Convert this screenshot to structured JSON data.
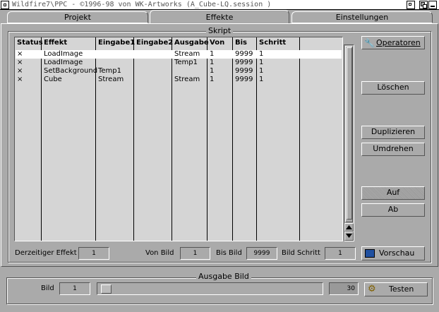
{
  "window": {
    "title": "Wildfire7\\PPC - ©1996-98 von WK-Artworks (A_Cube-LQ.session )"
  },
  "tabs": [
    {
      "label": "Projekt"
    },
    {
      "label": "Effekte"
    },
    {
      "label": "Einstellungen"
    }
  ],
  "script_group": {
    "title": "Skript",
    "columns": [
      "Status",
      "Effekt",
      "Eingabe1",
      "Eingabe2",
      "Ausgabe",
      "Von",
      "Bis",
      "Schritt"
    ],
    "rows": [
      {
        "status": "×",
        "effekt": "LoadImage",
        "eingabe1": "",
        "eingabe2": "",
        "ausgabe": "Stream",
        "von": "1",
        "bis": "9999",
        "schritt": "1"
      },
      {
        "status": "×",
        "effekt": "LoadImage",
        "eingabe1": "",
        "eingabe2": "",
        "ausgabe": "Temp1",
        "von": "1",
        "bis": "9999",
        "schritt": "1"
      },
      {
        "status": "×",
        "effekt": "SetBackground",
        "eingabe1": "Temp1",
        "eingabe2": "",
        "ausgabe": "",
        "von": "1",
        "bis": "9999",
        "schritt": "1"
      },
      {
        "status": "×",
        "effekt": "Cube",
        "eingabe1": "Stream",
        "eingabe2": "",
        "ausgabe": "Stream",
        "von": "1",
        "bis": "9999",
        "schritt": "1"
      }
    ],
    "buttons": {
      "operatoren": "Operatoren",
      "loeschen": "Löschen",
      "duplizieren": "Duplizieren",
      "umdrehen": "Umdrehen",
      "auf": "Auf",
      "ab": "Ab",
      "vorschau": "Vorschau"
    },
    "fields": {
      "derzeitiger_effekt_label": "Derzeitiger Effekt",
      "derzeitiger_effekt_value": "1",
      "von_bild_label": "Von Bild",
      "von_bild_value": "1",
      "bis_bild_label": "Bis Bild",
      "bis_bild_value": "9999",
      "bild_schritt_label": "Bild Schritt",
      "bild_schritt_value": "1"
    }
  },
  "output_group": {
    "title": "Ausgabe Bild",
    "bild_label": "Bild",
    "bild_value": "1",
    "slider_max_value": "30",
    "testen_label": "Testen"
  }
}
